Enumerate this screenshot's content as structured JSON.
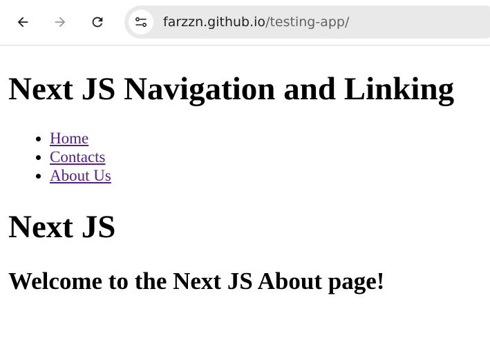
{
  "browser": {
    "url_host": "farzzn.github.io",
    "url_path": "/testing-app/",
    "icons": {
      "back": "arrow-left-icon",
      "forward": "arrow-right-icon",
      "reload": "reload-icon",
      "site_info": "tune-icon"
    }
  },
  "page": {
    "main_heading": "Next JS Navigation and Linking",
    "nav_links": [
      "Home",
      "Contacts",
      "About Us"
    ],
    "section_heading": "Next JS",
    "subheading": "Welcome to the Next JS About page!"
  },
  "colors": {
    "visited_link": "#551a8b",
    "omnibox_bg": "#e9e9e9"
  }
}
